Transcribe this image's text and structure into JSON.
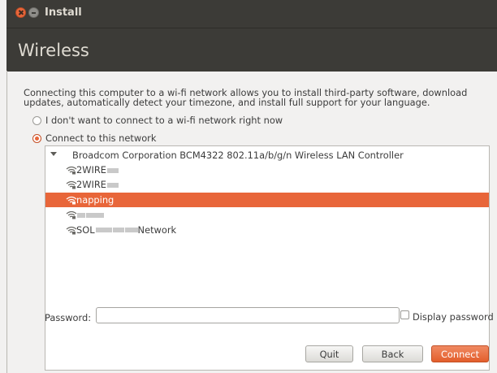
{
  "window": {
    "title": "Install"
  },
  "header": {
    "title": "Wireless"
  },
  "description": "Connecting this computer to a wi-fi network allows you to install third-party software, download updates, automatically detect your timezone, and install full support for your language.",
  "options": {
    "no_wifi": {
      "label": "I don't want to connect to a wi-fi network right now",
      "selected": false
    },
    "connect": {
      "label": "Connect to this network",
      "selected": true
    }
  },
  "network_list": {
    "adapter": "Broadcom Corporation BCM4322 802.11a/b/g/n Wireless LAN Controller",
    "networks": [
      {
        "prefix": "2WIRE",
        "suffix": "",
        "selected": false
      },
      {
        "prefix": "2WIRE",
        "suffix": "",
        "selected": false
      },
      {
        "prefix": "napping",
        "suffix": "",
        "selected": true
      },
      {
        "prefix": "",
        "suffix": "",
        "selected": false
      },
      {
        "prefix": "SOL",
        "suffix": "Network",
        "selected": false
      }
    ]
  },
  "password": {
    "label": "Password:",
    "value": "",
    "placeholder": ""
  },
  "display_password": {
    "label": "Display password",
    "checked": false
  },
  "buttons": {
    "quit": "Quit",
    "back": "Back",
    "connect": "Connect"
  },
  "colors": {
    "accent": "#e8663a",
    "titlebar": "#3c3b37",
    "background": "#f2f1f0"
  }
}
